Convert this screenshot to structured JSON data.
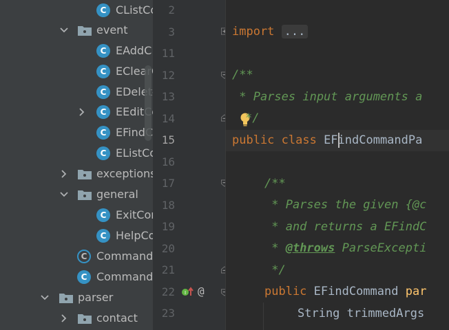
{
  "project_tree": {
    "items": [
      {
        "label": "CListCo",
        "type": "class"
      },
      {
        "label": "event",
        "type": "folder",
        "expanded": true
      },
      {
        "label": "EAddC",
        "type": "class"
      },
      {
        "label": "EClearC",
        "type": "class"
      },
      {
        "label": "EDelete",
        "type": "class"
      },
      {
        "label": "EEditCo",
        "type": "class",
        "collapsed_arrow": true
      },
      {
        "label": "EFindCo",
        "type": "class"
      },
      {
        "label": "EListCo",
        "type": "class"
      },
      {
        "label": "exceptions",
        "type": "folder",
        "expanded": false
      },
      {
        "label": "general",
        "type": "folder",
        "expanded": true
      },
      {
        "label": "ExitCom",
        "type": "class"
      },
      {
        "label": "HelpCo",
        "type": "class"
      },
      {
        "label": "Command",
        "type": "abstract-class"
      },
      {
        "label": "Command",
        "type": "class"
      },
      {
        "label": "parser",
        "type": "folder",
        "expanded": true
      },
      {
        "label": "contact",
        "type": "folder",
        "expanded": false
      }
    ]
  },
  "editor": {
    "current_line": "15",
    "line_numbers": [
      "2",
      "3",
      "11",
      "12",
      "13",
      "14",
      "15",
      "16",
      "17",
      "18",
      "19",
      "20",
      "21",
      "22",
      "23"
    ],
    "gutter_markers": {
      "implements_icon": "implements-icon",
      "annotation": "@"
    },
    "lines": {
      "l3_kw": "import",
      "l3_fold": "...",
      "l12": "/**",
      "l13": " * Parses input arguments a",
      "l14": "*/",
      "l15_kw": "public class ",
      "l15_ident": "EFindCommandPa",
      "l17": "/**",
      "l18": " * Parses the given {@c",
      "l19": " * and returns a EFindC",
      "l20_pre": " * ",
      "l20_tag": "@throws",
      "l20_post": " ParseExcepti",
      "l21": " */",
      "l22_kw": "public ",
      "l22_type": "EFindCommand ",
      "l22_ident": "par",
      "l23": "String trimmedArgs"
    }
  },
  "colors": {
    "keyword": "#cc7832",
    "comment": "#629755",
    "identifier": "#ffc66d",
    "class_icon": "#3592c4",
    "tree_bg": "#3c3f41",
    "editor_bg": "#2b2b2b"
  }
}
